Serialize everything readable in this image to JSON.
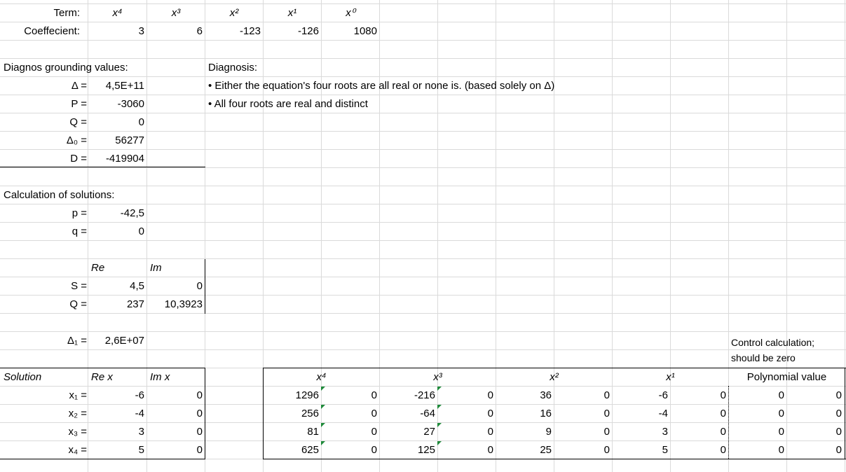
{
  "header": {
    "term_label": "Term:",
    "coef_label": "Coeffecient:",
    "terms": [
      "x⁴",
      "x³",
      "x²",
      "x¹",
      "x⁰"
    ],
    "coefficients": [
      "3",
      "6",
      "-123",
      "-126",
      "1080"
    ]
  },
  "diag": {
    "title": "Diagnos grounding values:",
    "rows": [
      {
        "label": "Δ =",
        "value": "4,5E+11"
      },
      {
        "label": "P =",
        "value": "-3060"
      },
      {
        "label": "Q =",
        "value": "0"
      },
      {
        "label": "Δ₀ =",
        "value": "56277"
      },
      {
        "label": "D =",
        "value": "-419904"
      }
    ],
    "diagnosis_title": "Diagnosis:",
    "diagnosis_lines": [
      "• Either the equation's four roots are all real or none is. (based solely on Δ)",
      "• All four roots are real and distinct"
    ]
  },
  "calc": {
    "title": "Calculation of solutions:",
    "p_label": "p =",
    "p_value": "-42,5",
    "q_label": "q =",
    "q_value": "0",
    "re_header": "Re",
    "im_header": "Im",
    "s_label": "S =",
    "s_re": "4,5",
    "s_im": "0",
    "Q_label": "Q =",
    "Q_re": "237",
    "Q_im": "10,3923",
    "delta1_label": "Δ₁ =",
    "delta1_value": "2,6E+07"
  },
  "solutions": {
    "header": "Solution",
    "re_header": "Re x",
    "im_header": "Im x",
    "rows": [
      {
        "label": "x₁ =",
        "re": "-6",
        "im": "0"
      },
      {
        "label": "x₂ =",
        "re": "-4",
        "im": "0"
      },
      {
        "label": "x₃ =",
        "re": "3",
        "im": "0"
      },
      {
        "label": "x₄ =",
        "re": "5",
        "im": "0"
      }
    ]
  },
  "control": {
    "note_line1": "Control calculation;",
    "note_line2": "should be zero",
    "terms": [
      "x⁴",
      "x³",
      "x²",
      "x¹"
    ],
    "poly_header": "Polynomial value",
    "rows": [
      [
        "1296",
        "0",
        "-216",
        "0",
        "36",
        "0",
        "-6",
        "0",
        "0",
        "0"
      ],
      [
        "256",
        "0",
        "-64",
        "0",
        "16",
        "0",
        "-4",
        "0",
        "0",
        "0"
      ],
      [
        "81",
        "0",
        "27",
        "0",
        "9",
        "0",
        "3",
        "0",
        "0",
        "0"
      ],
      [
        "625",
        "0",
        "125",
        "0",
        "25",
        "0",
        "5",
        "0",
        "0",
        "0"
      ]
    ]
  }
}
